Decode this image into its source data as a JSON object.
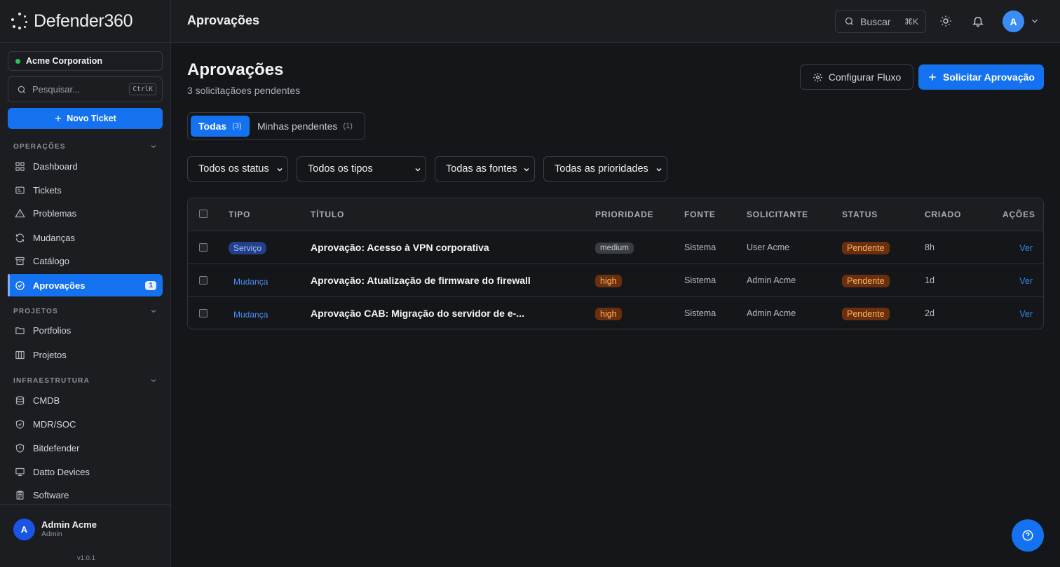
{
  "brand": {
    "name": "Defender360"
  },
  "sidebar": {
    "org": "Acme Corporation",
    "search_placeholder": "Pesquisar...",
    "search_kbd": "CtrlK",
    "new_ticket": "Novo Ticket",
    "sections": [
      {
        "title": "OPERAÇÕES",
        "items": [
          {
            "label": "Dashboard",
            "icon": "grid-icon"
          },
          {
            "label": "Tickets",
            "icon": "ticket-icon"
          },
          {
            "label": "Problemas",
            "icon": "warning-icon"
          },
          {
            "label": "Mudanças",
            "icon": "refresh-icon"
          },
          {
            "label": "Catálogo",
            "icon": "archive-icon"
          },
          {
            "label": "Aprovações",
            "icon": "check-circle-icon",
            "active": true,
            "badge": "1"
          }
        ]
      },
      {
        "title": "PROJETOS",
        "items": [
          {
            "label": "Portfolios",
            "icon": "folder-icon"
          },
          {
            "label": "Projetos",
            "icon": "columns-icon"
          }
        ]
      },
      {
        "title": "INFRAESTRUTURA",
        "items": [
          {
            "label": "CMDB",
            "icon": "database-icon"
          },
          {
            "label": "MDR/SOC",
            "icon": "shield-check-icon"
          },
          {
            "label": "Bitdefender",
            "icon": "shield-alert-icon"
          },
          {
            "label": "Datto Devices",
            "icon": "monitor-icon"
          },
          {
            "label": "Software",
            "icon": "clipboard-icon"
          }
        ]
      }
    ],
    "user": {
      "initial": "A",
      "name": "Admin Acme",
      "role": "Admin"
    },
    "version": "v1.0.1"
  },
  "topbar": {
    "title": "Aprovações",
    "search_label": "Buscar",
    "search_kbd": "⌘K",
    "avatar_initial": "A"
  },
  "page": {
    "title": "Aprovações",
    "subtitle": "3 solicitaçãoes pendentes",
    "config_button": "Configurar Fluxo",
    "request_button": "Solicitar Aprovação"
  },
  "tabs": [
    {
      "label": "Todas",
      "count": "(3)",
      "active": true
    },
    {
      "label": "Minhas pendentes",
      "count": "(1)",
      "active": false
    }
  ],
  "filters": [
    "Todos os status",
    "Todos os tipos",
    "Todas as fontes",
    "Todas as prioridades"
  ],
  "table": {
    "headers": [
      "TIPO",
      "TÍTULO",
      "PRIORIDADE",
      "FONTE",
      "SOLICITANTE",
      "STATUS",
      "CRIADO",
      "AÇÕES"
    ],
    "rows": [
      {
        "tipo": "Serviço",
        "titulo": "Aprovação: Acesso à VPN corporativa",
        "prioridade": "medium",
        "fonte": "Sistema",
        "solicitante": "User Acme",
        "status": "Pendente",
        "criado": "8h",
        "acao": "Ver"
      },
      {
        "tipo": "Mudança",
        "titulo": "Aprovação: Atualização de firmware do firewall",
        "prioridade": "high",
        "fonte": "Sistema",
        "solicitante": "Admin Acme",
        "status": "Pendente",
        "criado": "1d",
        "acao": "Ver"
      },
      {
        "tipo": "Mudança",
        "titulo": "Aprovação CAB: Migração do servidor de e-...",
        "prioridade": "high",
        "fonte": "Sistema",
        "solicitante": "Admin Acme",
        "status": "Pendente",
        "criado": "2d",
        "acao": "Ver"
      }
    ]
  },
  "colors": {
    "accent": "#1472f0",
    "background": "#141619",
    "warning": "#fbb461"
  }
}
